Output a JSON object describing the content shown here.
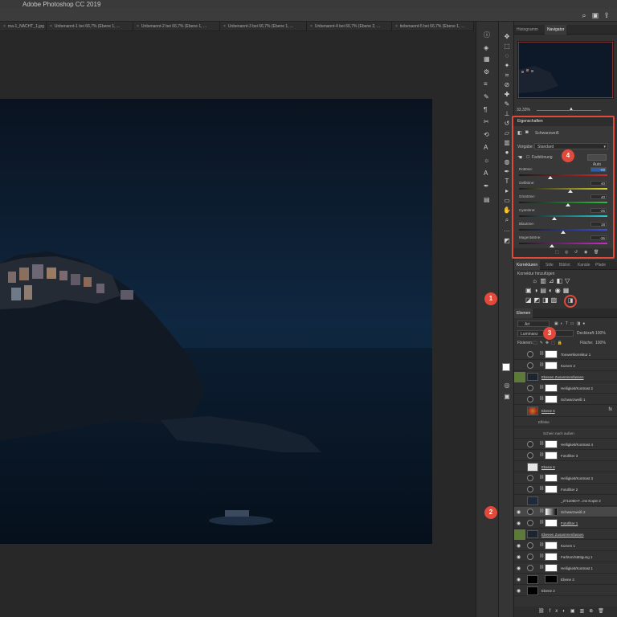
{
  "app": {
    "title": "Adobe Photoshop CC 2019"
  },
  "tabs": [
    "ma-1_NACHT_1.jpg",
    "Unbenannt-1 bei 66,7% (Ebene 1, ...",
    "Unbenannt-2 bei 66,7% (Ebene 1, ...",
    "Unbenannt-3 bei 66,7% (Ebene 1, ...",
    "Unbenannt-4 bei 66,7% (Ebene 2, ...",
    "tiebenannt-5 bei 66,7% (Ebene 1, ..."
  ],
  "navigator": {
    "tabs": [
      "Histogramm",
      "Navigator"
    ],
    "zoom": "33,33%"
  },
  "properties": {
    "tab": "Eigenschaften",
    "adjustment": "Schwarzweiß",
    "preset_label": "Vorgabe:",
    "preset_value": "Standard",
    "tint_label": "Farbtönung",
    "auto_label": "Auto",
    "sliders": [
      {
        "label": "Rottöne:",
        "value": "-69",
        "pos": 0.35
      },
      {
        "label": "Gelbtöne:",
        "value": "40",
        "pos": 0.58
      },
      {
        "label": "Grüntöne:",
        "value": "40",
        "pos": 0.55
      },
      {
        "label": "Cyantöne:",
        "value": "-25",
        "pos": 0.4
      },
      {
        "label": "Blautöne:",
        "value": "18",
        "pos": 0.5
      },
      {
        "label": "Magentatöne:",
        "value": "-36",
        "pos": 0.37
      }
    ]
  },
  "corrections": {
    "tabs": [
      "Korrekturen",
      "Stile",
      "Bibliot",
      "Kanäle",
      "Pfade"
    ],
    "add_label": "Korrektur hinzufügen"
  },
  "layers": {
    "tab": "Ebenen",
    "filter": "Art",
    "blend_mode": "Luminanz",
    "opacity_label": "Deckkraft:",
    "opacity_value": "100%",
    "lock_label": "Fixieren:",
    "fill_label": "Fläche:",
    "fill_value": "100%",
    "rows": [
      {
        "name": "Tonwertkorrektur 1"
      },
      {
        "name": "Kurven 2"
      },
      {
        "name": "Ebenen Zusammenfassen"
      },
      {
        "name": "Helligkeit/Kontrast 2"
      },
      {
        "name": "Schwarzweiß 1"
      },
      {
        "name": "Ebene 5"
      },
      {
        "name": "Effekte"
      },
      {
        "name": "Schein nach außen"
      },
      {
        "name": "Helligkeit/Kontrast 4"
      },
      {
        "name": "Fotofilter 3"
      },
      {
        "name": "Ebene 6"
      },
      {
        "name": "Helligkeit/Kontrast 3"
      },
      {
        "name": "Fotofilter 2"
      },
      {
        "name": "_2711060-F...ms Kopie 2"
      },
      {
        "name": "Schwarzweiß 2"
      },
      {
        "name": "Fotofilter 1"
      },
      {
        "name": "Ebenen Zusammenfassen"
      },
      {
        "name": "Kurven 1"
      },
      {
        "name": "Farbton/Sättigung 1"
      },
      {
        "name": "Helligkeit/Kontrast 1"
      },
      {
        "name": "Ebene 3"
      },
      {
        "name": "Ebene 2"
      }
    ]
  },
  "badges": [
    "1",
    "2",
    "3",
    "4"
  ],
  "colors": {
    "accent_red": "#e3493a",
    "panel_bg": "#323232",
    "canvas_bg": "#282828"
  }
}
